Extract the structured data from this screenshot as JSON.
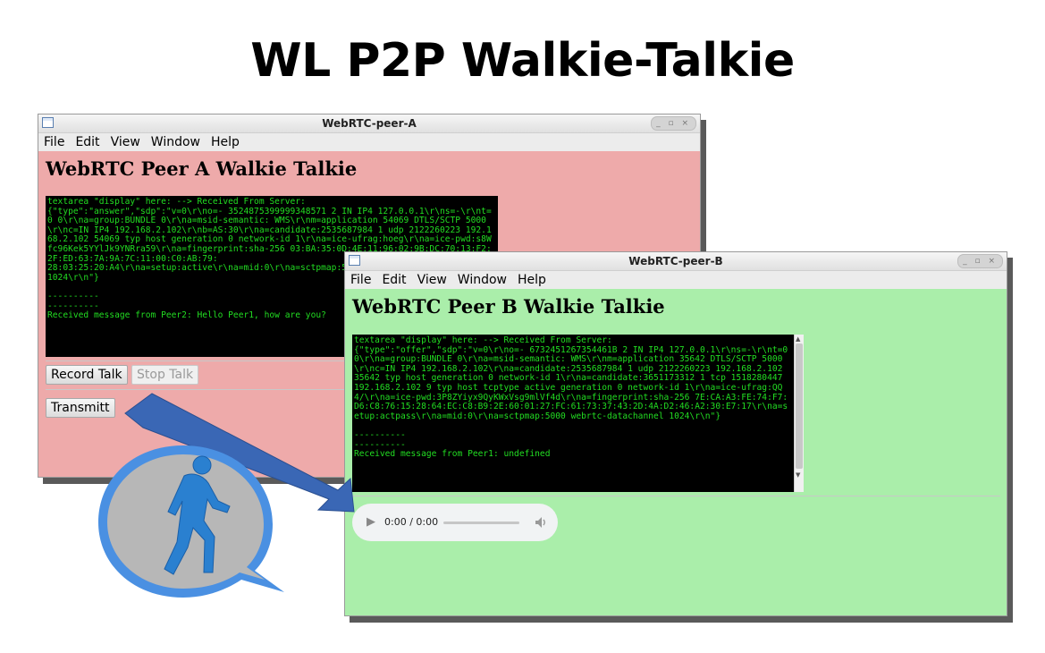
{
  "page_title": "WL P2P Walkie-Talkie",
  "menu": [
    "File",
    "Edit",
    "View",
    "Window",
    "Help"
  ],
  "window_controls": "_ ▫ ×",
  "icon_names": [
    "window-icon",
    "walking-person-icon",
    "play-icon",
    "volume-icon",
    "arrow-icon"
  ],
  "colors": {
    "peer_a_bg": "#eeaaaa",
    "peer_b_bg": "#aaeeaa",
    "terminal_text": "#22dd22",
    "arrow": "#3a67b5",
    "bubble_ring": "#4a90e2"
  },
  "peer_a": {
    "window_title": "WebRTC-peer-A",
    "heading": "WebRTC Peer A Walkie Talkie",
    "display_text": "textarea \"display\" here: --> Received From Server:\n{\"type\":\"answer\",\"sdp\":\"v=0\\r\\no=- 3524875399999348571 2 IN IP4 127.0.0.1\\r\\ns=-\\r\\nt=0 0\\r\\na=group:BUNDLE 0\\r\\na=msid-semantic: WMS\\r\\nm=application 54069 DTLS/SCTP 5000\\r\\nc=IN IP4 192.168.2.102\\r\\nb=AS:30\\r\\na=candidate:2535687984 1 udp 2122260223 192.168.2.102 54069 typ host generation 0 network-id 1\\r\\na=ice-ufrag:hoeg\\r\\na=ice-pwd:s8Wfc96Kek5YYlJk9YNRra59\\r\\na=fingerprint:sha-256 03:BA:35:0D:4E:11:96:02:9B:DC:70:13:F2:2F:ED:63:7A:9A:7C:11:00:C0:AB:79:\n28:03:25:20:A4\\r\\na=setup:active\\r\\na=mid:0\\r\\na=sctpmap:5000 webrtc-datachannel\n1024\\r\\n\"}\n\n----------\n----------\nReceived message from Peer2: Hello Peer1, how are you?",
    "record_label": "Record Talk",
    "stop_label": "Stop Talk",
    "transmit_label": "Transmitt"
  },
  "peer_b": {
    "window_title": "WebRTC-peer-B",
    "heading": "WebRTC Peer B Walkie Talkie",
    "display_text": "textarea \"display\" here: --> Received From Server:\n{\"type\":\"offer\",\"sdp\":\"v=0\\r\\no=- 6732451267354461B 2 IN IP4 127.0.0.1\\r\\ns=-\\r\\nt=0 0\\r\\na=group:BUNDLE 0\\r\\na=msid-semantic: WMS\\r\\nm=application 35642 DTLS/SCTP 5000\\r\\nc=IN IP4 192.168.2.102\\r\\na=candidate:2535687984 1 udp 2122260223 192.168.2.102 35642 typ host generation 0 network-id 1\\r\\na=candidate:3651173312 1 tcp 1518280447 192.168.2.102 9 typ host tcptype active generation 0 network-id 1\\r\\na=ice-ufrag:QQ4/\\r\\na=ice-pwd:3P8ZYiyx9QyKWxVsg9mlVf4d\\r\\na=fingerprint:sha-256 7E:CA:A3:FE:74:F7:D6:C8:76:15:28:64:EC:C8:B9:2E:60:01:27:FC:61:73:37:43:2D:4A:D2:46:A2:30:E7:17\\r\\na=setup:actpass\\r\\na=mid:0\\r\\na=sctpmap:5000 webrtc-datachannel 1024\\r\\n\"}\n\n----------\n----------\nReceived message from Peer1: undefined",
    "audio_time": "0:00 / 0:00"
  }
}
